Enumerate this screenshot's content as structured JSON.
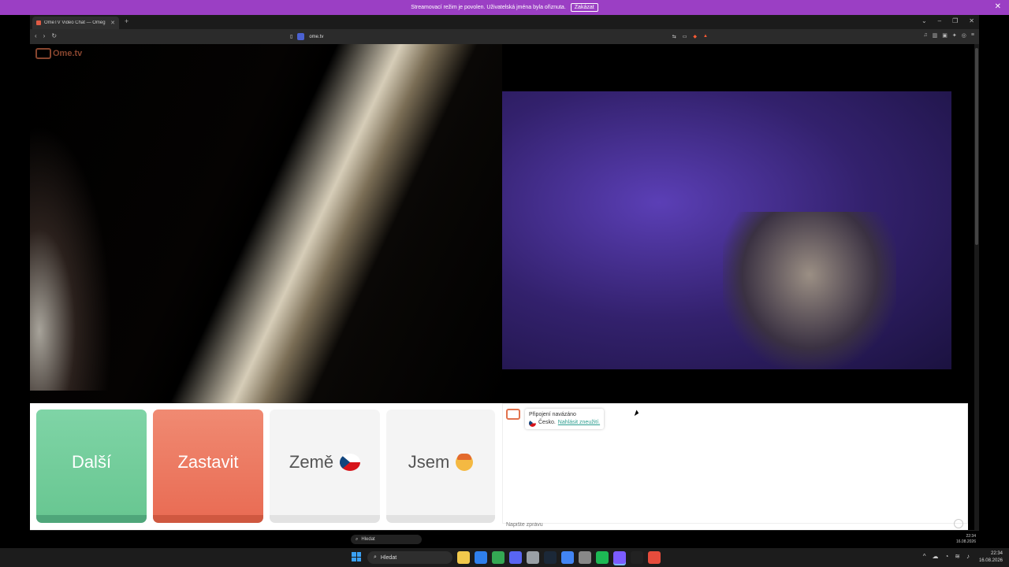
{
  "banner": {
    "message": "Streamovací režim je povolen. Uživatelská jména byla ořiznuta.",
    "stop_label": "Zakázat",
    "close_label": "✕"
  },
  "browser": {
    "tab_title": "OmeTV Video Chat — Omeg",
    "tab_close": "✕",
    "new_tab": "+",
    "window_controls": [
      "⌄",
      "–",
      "❐",
      "✕"
    ],
    "url": "ome.tv",
    "nav": [
      "‹",
      "›",
      "↻"
    ]
  },
  "page": {
    "logo_text": "Ome.tv",
    "buttons": {
      "next": "Další",
      "stop": "Zastavit",
      "country": "Země",
      "gender": "Jsem"
    },
    "chat": {
      "status": "Připojení navázáno",
      "country": "Česko.",
      "report_link": "Nahlásit zneužití.",
      "input_placeholder": "Napište zprávu"
    }
  },
  "inner_taskbar": {
    "search_label": "Hledat",
    "time": "22:34",
    "date": "16.08.2026"
  },
  "taskbar": {
    "search_label": "Hledat",
    "time": "22:34",
    "date": "16.08.2026",
    "app_colors": [
      "#f2c94c",
      "#2f80ed",
      "#34a853",
      "#5865f2",
      "#9aa0a6",
      "#1b2838",
      "#4285f4",
      "#888888",
      "#1db954",
      "#7b5cff",
      "#222222",
      "#e74c3c"
    ]
  }
}
